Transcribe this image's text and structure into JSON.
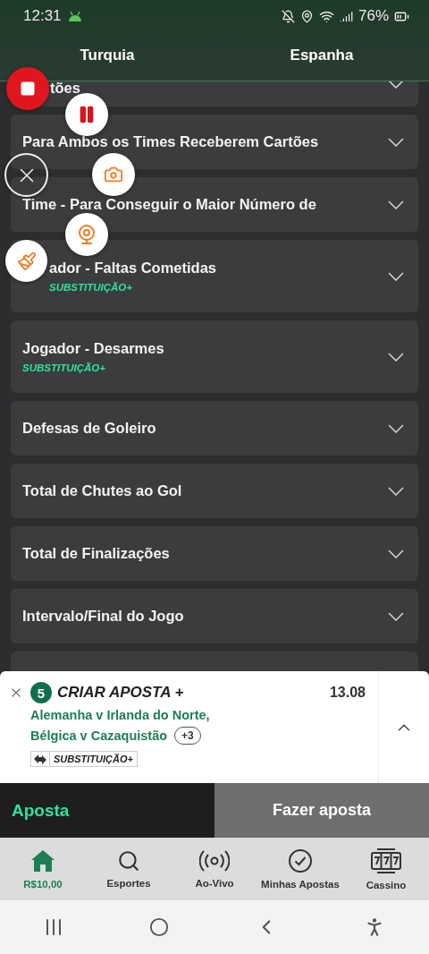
{
  "status_bar": {
    "time": "12:31",
    "battery": "76%"
  },
  "tabs": [
    {
      "label": "Turquia",
      "selected": false
    },
    {
      "label": "Espanha",
      "selected": false
    }
  ],
  "markets": [
    {
      "kind": "partial",
      "title": "tões",
      "expanded": false
    },
    {
      "kind": "row",
      "title": "Para Ambos os Times Receberem Cartões",
      "expanded": false
    },
    {
      "kind": "row",
      "title": "Time - Para Conseguir o Maior Número de",
      "expanded": false
    },
    {
      "kind": "row",
      "title": "ador - Faltas Cometidas",
      "badge": "SUBSTITUIÇÃO+",
      "expanded": false
    },
    {
      "kind": "row",
      "title": "Jogador - Desarmes",
      "badge": "SUBSTITUIÇÃO+",
      "expanded": false
    },
    {
      "kind": "row",
      "title": "Defesas de Goleiro",
      "expanded": false
    },
    {
      "kind": "row",
      "title": "Total de Chutes ao Gol",
      "expanded": false
    },
    {
      "kind": "row",
      "title": "Total de Finalizações",
      "expanded": false
    },
    {
      "kind": "row",
      "title": "Intervalo/Final do Jogo",
      "expanded": false
    },
    {
      "kind": "empty"
    }
  ],
  "bet_slip": {
    "count": "5",
    "title": "CRIAR APOSTA +",
    "odds": "13.08",
    "events": [
      "Alemanha v Irlanda do Norte,",
      "Bélgica v Cazaquistão"
    ],
    "more": "+3",
    "tag": "SUBSTITUIÇÃO+",
    "expanded": false
  },
  "action_bar": {
    "label": "Aposta",
    "button": "Fazer aposta"
  },
  "bottom_nav": [
    {
      "label": "R$10,00",
      "selected": true
    },
    {
      "label": "Esportes",
      "selected": false
    },
    {
      "label": "Ao-Vivo",
      "selected": false
    },
    {
      "label": "Minhas Apostas",
      "selected": false
    },
    {
      "label": "Cassino",
      "selected": false
    }
  ]
}
